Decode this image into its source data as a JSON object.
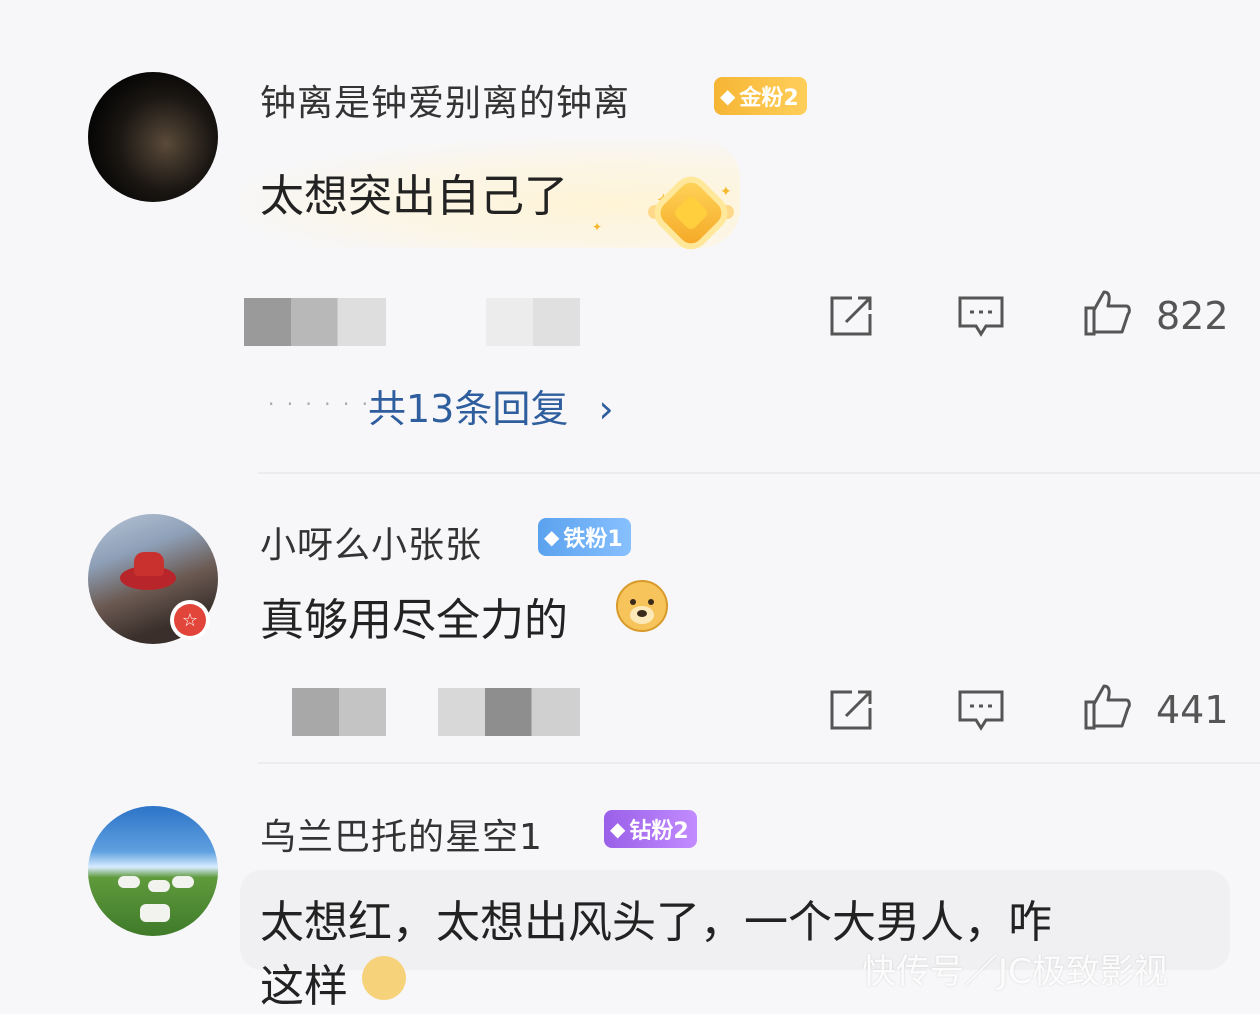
{
  "comments": [
    {
      "username": "钟离是钟爱别离的钟离",
      "fan_badge": {
        "label": "金粉2",
        "icon": "gold-gem-icon",
        "color": "#f6b534"
      },
      "content": "太想突出自己了",
      "likes": "822",
      "replies_link": "共13条回复",
      "replies_arrow": "›"
    },
    {
      "username": "小呀么小张张",
      "fan_badge": {
        "label": "铁粉1",
        "icon": "iron-gem-icon",
        "color": "#5aa2ee"
      },
      "content": "真够用尽全力的",
      "likes": "441",
      "verified_badge": "☆"
    },
    {
      "username": "乌兰巴托的星空1",
      "fan_badge": {
        "label": "钻粉2",
        "icon": "diamond-gem-icon",
        "color": "#9a5fe8"
      },
      "content": "太想红，太想出风头了，一个大男人，咋",
      "content_cut": "这样"
    }
  ],
  "watermark": "快传号／JC极致影视",
  "icons": {
    "share": "share-icon",
    "comment": "comment-icon",
    "like": "thumbs-up-icon"
  }
}
